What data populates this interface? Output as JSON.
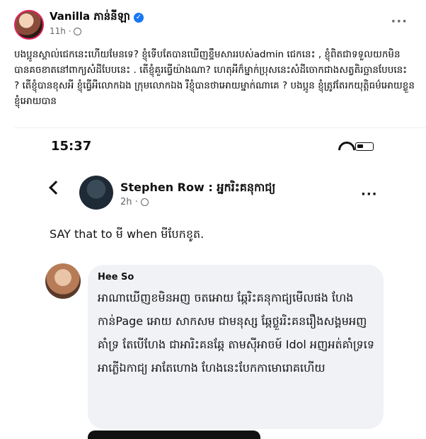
{
  "post": {
    "author": "Vanilla ភាន់នីឡា",
    "time": "11h ·",
    "text": "បងប្អូនស្គាល់ជេកនេះហើយមែនទេ? ខ្ញុំទើបតែបានឃើញខ្ទឹមសាររបស់admin ជេកនេះ , ខ្ញុំពិតជាទទួលយកមិនបានគចខាតនៅពាក្យសំដីបែបនេះ . តើខ្ញុំគួរធ្វើយ៉ាងណា? ហេតុអីក៏ម្នាក់ប្រុសនេះសំដីចោកជាងសត្វតិរច្ឆានបែបនេះ ? តើខ្ញុំបានខុសអី ខ្ញុំធ្វើអីលោកឯង ក្រុមលោកឯង រឺខ្ញុំបានថាអោយម្នាក់ណាគេ ? បងប្អូន ខ្ញុំត្រូវតែរកយុត្តិធម៌អោយខ្លួនខ្ញុំអោយបាន"
  },
  "screenshot": {
    "status_time": "15:37",
    "commenter": {
      "name": "Stephen Row : អ្នករិះគនុកាជ្យ",
      "time": "2h ·",
      "text": "SAY that to មី when មីបែកខូត."
    },
    "reply": {
      "name": "Hee So",
      "text": "អាណាឃើញខមិនអញ ចតអោយ ឆ្កែរិះគនុកាជ្យមើលផង ហែងកាន់Page អោយ សាកសម ជាមនុស្ស ឆ្កែថ្លួររិះគនរឿងសង្គមអញគាំទ្រ តែបើហែង ជាអារិះគនឆ្កែ តាមសុីអាចម៍ Idol អញអត់គាំទ្រទេ អាភ្លើឯកាជ្យ អាតែហោង ហែងនេះបែកកាមោរោគហើយ"
    }
  },
  "colors": {
    "verified": "#1877f2",
    "bubble": "#f0f2f5",
    "meta_text": "#65676b"
  },
  "icons": [
    "verified-icon",
    "globe-icon",
    "more-icon",
    "wifi-icon",
    "battery-icon",
    "back-icon"
  ]
}
